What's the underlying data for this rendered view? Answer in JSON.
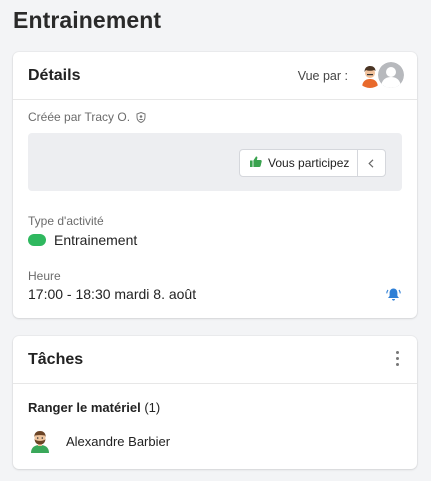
{
  "page": {
    "title": "Entrainement"
  },
  "details": {
    "header_title": "Détails",
    "viewed_by_label": "Vue par :",
    "created_by": "Créée par Tracy O.",
    "participate_label": "Vous participez",
    "activity_type_label": "Type d'activité",
    "activity_type_value": "Entrainement",
    "activity_color": "#2fb85f",
    "time_label": "Heure",
    "time_value": "17:00 - 18:30 mardi 8. août"
  },
  "tasks": {
    "header_title": "Tâches",
    "task_name": "Ranger le matériel",
    "task_count": "(1)",
    "assignee_name": "Alexandre Barbier"
  },
  "icons": {
    "shield": "shield-icon",
    "thumb": "thumbs-up-icon",
    "chevron": "chevron-left-icon",
    "bell": "bell-icon",
    "kebab": "kebab-menu-icon"
  }
}
